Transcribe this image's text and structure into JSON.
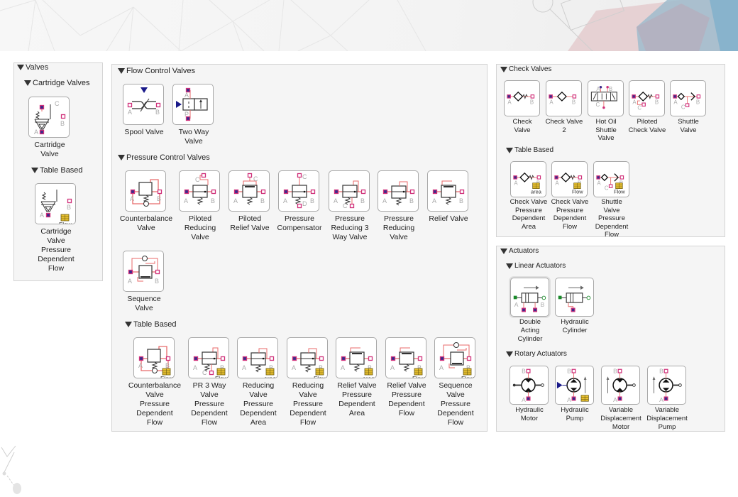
{
  "panels": {
    "valves": {
      "title": "Valves",
      "cartridge": {
        "title": "Cartridge Valves",
        "blocks": [
          "Cartridge\nValve"
        ],
        "table_based": {
          "title": "Table Based",
          "blocks": [
            "Cartridge\nValve\nPressure\nDependent\nFlow"
          ]
        }
      }
    },
    "flow_pressure": {
      "flow_control": {
        "title": "Flow Control Valves",
        "blocks": [
          "Spool Valve",
          "Two Way\nValve"
        ]
      },
      "pressure_control": {
        "title": "Pressure Control Valves",
        "blocks": [
          "Counterbalance\nValve",
          "Piloted\nReducing\nValve",
          "Piloted\nRelief Valve",
          "Pressure\nCompensator",
          "Pressure\nReducing 3\nWay Valve",
          "Pressure\nReducing\nValve",
          "Relief Valve",
          "Sequence\nValve"
        ],
        "table_based": {
          "title": "Table Based",
          "blocks": [
            "Counterbalance\nValve\nPressure\nDependent\nFlow",
            "PR 3 Way\nValve\nPressure\nDependent\nFlow",
            "Reducing\nValve\nPressure\nDependent\nArea",
            "Reducing\nValve\nPressure\nDependent\nFlow",
            "Relief Valve\nPressure\nDependent\nArea",
            "Relief Valve\nPressure\nDependent\nFlow",
            "Sequence\nValve\nPressure\nDependent\nFlow"
          ]
        }
      }
    },
    "check": {
      "title": "Check Valves",
      "blocks": [
        "Check\nValve",
        "Check Valve\n2",
        "Hot Oil\nShuttle\nValve",
        "Piloted\nCheck Valve",
        "Shuttle\nValve"
      ],
      "table_based": {
        "title": "Table Based",
        "blocks": [
          "Check Valve\nPressure\nDependent\nArea",
          "Check Valve\nPressure\nDependent\nFlow",
          "Shuttle\nValve\nPressure\nDependent\nFlow"
        ]
      }
    },
    "actuators": {
      "title": "Actuators",
      "linear": {
        "title": "Linear Actuators",
        "blocks": [
          "Double\nActing\nCylinder",
          "Hydraulic\nCylinder"
        ]
      },
      "rotary": {
        "title": "Rotary Actuators",
        "blocks": [
          "Hydraulic\nMotor",
          "Hydraulic\nPump",
          "Variable\nDisplacement\nMotor",
          "Variable\nDisplacement\nPump"
        ]
      }
    }
  },
  "port_labels": {
    "a": "A",
    "b": "B",
    "c": "C",
    "d": "D",
    "p": "P"
  },
  "table_tags": {
    "flow": "Flow",
    "area": "area"
  },
  "colors": {
    "port_fill": "#3a2a8a",
    "port_border": "#d0307a",
    "line": "#e86a6a",
    "input_arrow": "#1a1a8a",
    "table_icon": "#e8c030",
    "mech_port": "#1a8a2a"
  }
}
